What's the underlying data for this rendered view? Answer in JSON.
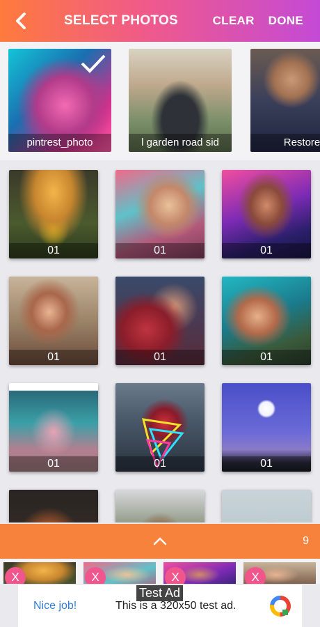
{
  "header": {
    "title": "SELECT PHOTOS",
    "clear_label": "CLEAR",
    "done_label": "DONE",
    "back_icon": "arrow-left-icon",
    "background": [
      "#ff7a3c",
      "#c44ad6"
    ]
  },
  "albums": [
    {
      "label": "pintrest_photo",
      "selected": true
    },
    {
      "label": "l garden road sid",
      "selected": false
    },
    {
      "label": "Restore",
      "selected": false
    }
  ],
  "photos": [
    "01",
    "01",
    "01",
    "01",
    "01",
    "01",
    "01",
    "01",
    "01"
  ],
  "tray": {
    "expand_icon": "chevron-up-icon",
    "selected_count": "9",
    "remove_label": "X",
    "accent": "#f6823c"
  },
  "ad": {
    "badge": "Test Ad",
    "nice_label": "Nice job!",
    "text": "This is a 320x50 test ad."
  }
}
